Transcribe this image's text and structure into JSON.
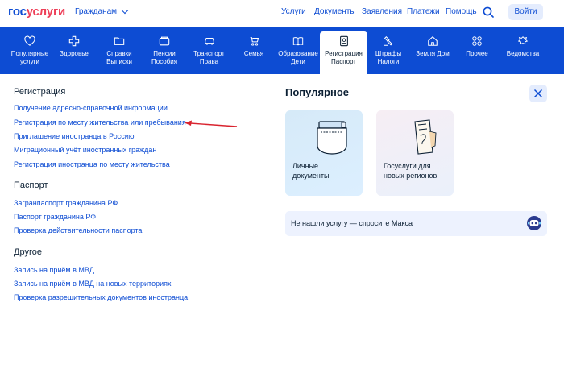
{
  "header": {
    "logo_part1": "гос",
    "logo_part2": "услуги",
    "audience": "Гражданам",
    "nav": [
      "Услуги",
      "Документы",
      "Заявления",
      "Платежи",
      "Помощь"
    ],
    "login_label": "Войти"
  },
  "categories": [
    {
      "line1": "Популярные",
      "line2": "услуги",
      "icon": "heart-icon"
    },
    {
      "line1": "Здоровье",
      "line2": "",
      "icon": "health-cross-icon"
    },
    {
      "line1": "Справки",
      "line2": "Выписки",
      "icon": "folder-icon"
    },
    {
      "line1": "Пенсии",
      "line2": "Пособия",
      "icon": "wallet-icon"
    },
    {
      "line1": "Транспорт",
      "line2": "Права",
      "icon": "car-icon"
    },
    {
      "line1": "Семья",
      "line2": "",
      "icon": "stroller-icon"
    },
    {
      "line1": "Образование",
      "line2": "Дети",
      "icon": "book-icon"
    },
    {
      "line1": "Регистрация",
      "line2": "Паспорт",
      "icon": "passport-icon"
    },
    {
      "line1": "Штрафы",
      "line2": "Налоги",
      "icon": "gavel-icon"
    },
    {
      "line1": "Земля Дом",
      "line2": "",
      "icon": "house-icon"
    },
    {
      "line1": "Прочее",
      "line2": "",
      "icon": "grid-icon"
    },
    {
      "line1": "Ведомства",
      "line2": "",
      "icon": "emblem-icon"
    }
  ],
  "sections": {
    "registration": {
      "title": "Регистрация",
      "links": [
        "Получение адресно-справочной информации",
        "Регистрация по месту жительства или пребывания",
        "Приглашение иностранца в Россию",
        "Миграционный учёт иностранных граждан",
        "Регистрация иностранца по месту жительства"
      ]
    },
    "passport": {
      "title": "Паспорт",
      "links": [
        "Загранпаспорт гражданина РФ",
        "Паспорт гражданина РФ",
        "Проверка действительности паспорта"
      ]
    },
    "other": {
      "title": "Другое",
      "links": [
        "Запись на приём в МВД",
        "Запись на приём в МВД на новых территориях",
        "Проверка разрешительных документов иностранца"
      ]
    }
  },
  "popular": {
    "title": "Популярное",
    "cards": [
      {
        "line1": "Личные",
        "line2": "документы",
        "icon": "personal-documents-icon"
      },
      {
        "line1": "Госуслуги для",
        "line2": "новых регионов",
        "icon": "new-regions-document-icon"
      }
    ],
    "ask_text": "Не нашли услугу — спросите Макса"
  },
  "colors": {
    "brand_blue": "#0d4cd3",
    "brand_red": "#ee3f58",
    "annotation_arrow": "#d9232e"
  }
}
